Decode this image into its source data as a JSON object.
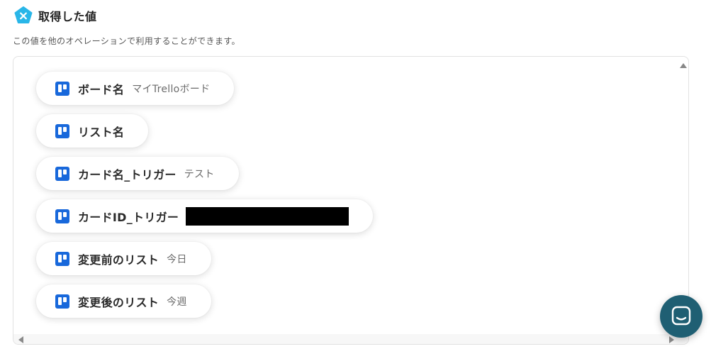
{
  "header": {
    "title": "取得した値",
    "logo_icon": "yoom-x-icon",
    "logo_color": "#29b6e8"
  },
  "description": "この値を他のオペレーションで利用することができます。",
  "items": [
    {
      "label": "ボード名",
      "value": "マイTrelloボード",
      "icon": "trello-icon"
    },
    {
      "label": "リスト名",
      "value": "",
      "icon": "trello-icon"
    },
    {
      "label": "カード名_トリガー",
      "value": "テスト",
      "icon": "trello-icon"
    },
    {
      "label": "カードID_トリガー",
      "value": "",
      "icon": "trello-icon",
      "redacted": true
    },
    {
      "label": "変更前のリスト",
      "value": "今日",
      "icon": "trello-icon"
    },
    {
      "label": "変更後のリスト",
      "value": "今週",
      "icon": "trello-icon"
    }
  ],
  "chat_button": {
    "icon": "chat-icon",
    "color": "#1f5f73"
  },
  "colors": {
    "trello_blue": "#1868db"
  }
}
